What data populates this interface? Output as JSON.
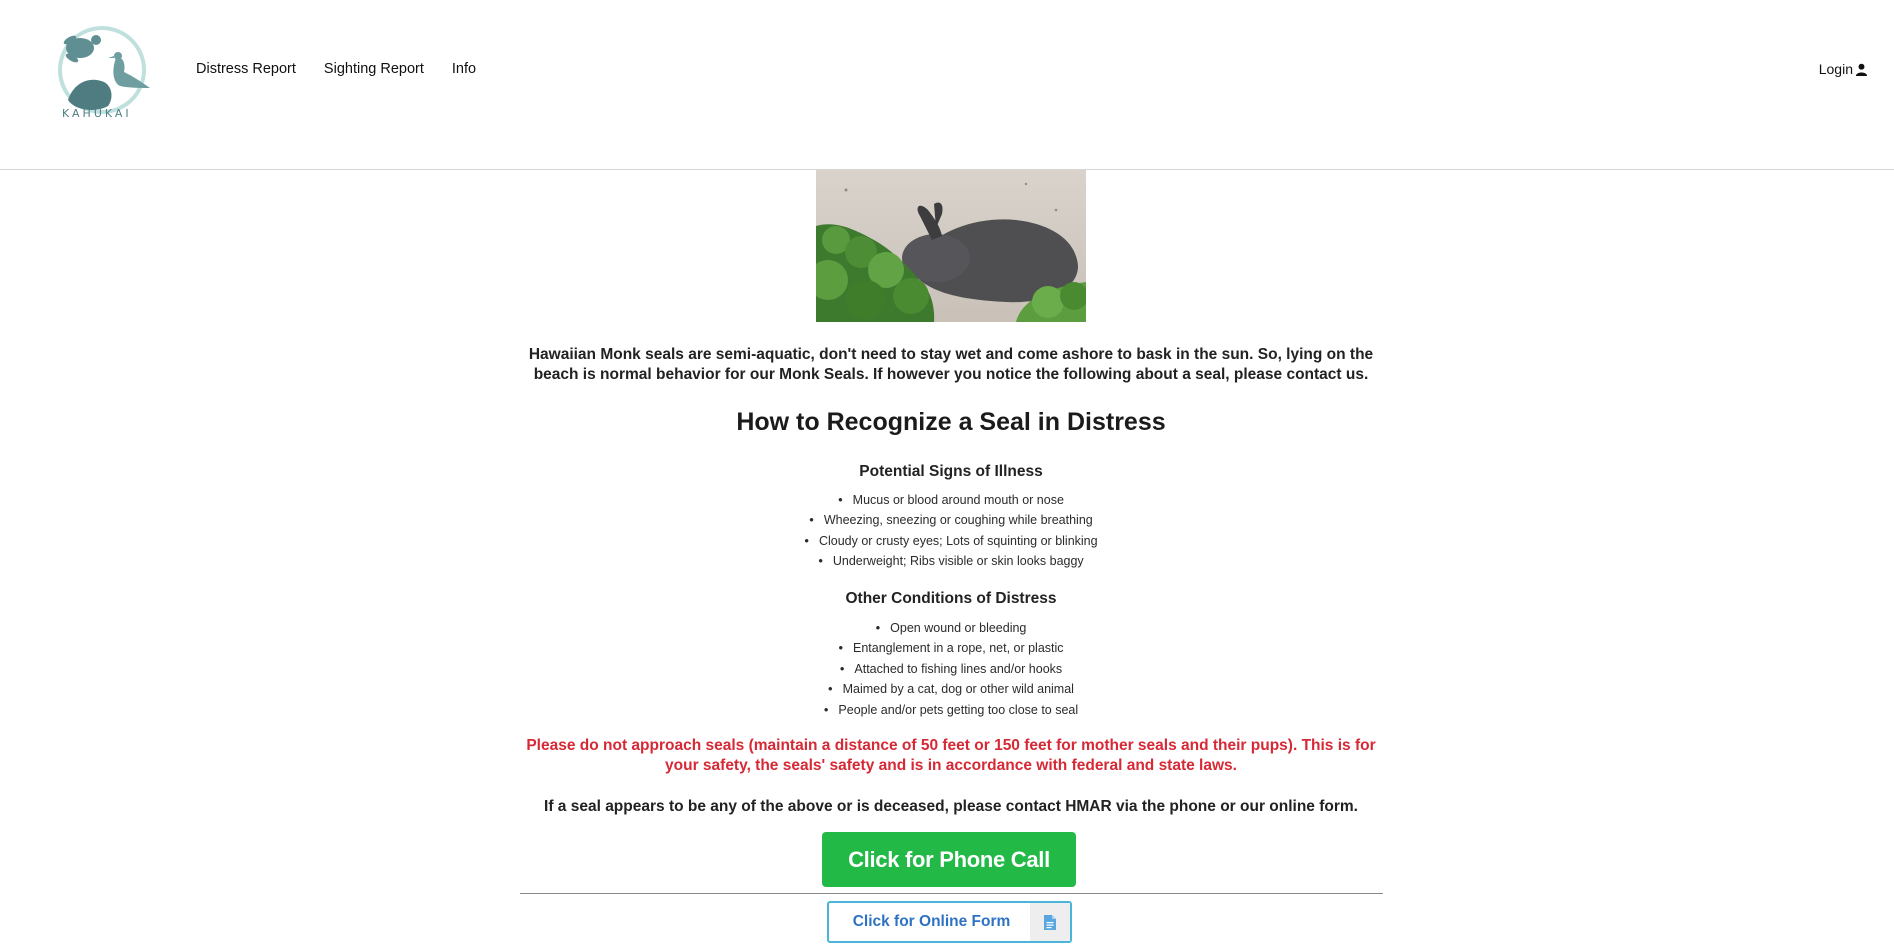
{
  "header": {
    "logo_text": "KAHUKAI",
    "nav": [
      "Distress Report",
      "Sighting Report",
      "Info"
    ],
    "login_label": "Login"
  },
  "main": {
    "intro": "Hawaiian Monk seals are semi-aquatic, don't need to stay wet and come ashore to bask in the sun. So, lying on the beach is normal behavior for our Monk Seals. If however you notice the following about a seal, please contact us.",
    "heading": "How to Recognize a Seal in Distress",
    "illness": {
      "title": "Potential Signs of Illness",
      "items": [
        "Mucus or blood around mouth or nose",
        "Wheezing, sneezing or coughing while breathing",
        "Cloudy or crusty eyes; Lots of squinting or blinking",
        "Underweight; Ribs visible or skin looks baggy"
      ]
    },
    "other": {
      "title": "Other Conditions of Distress",
      "items": [
        "Open wound or bleeding",
        "Entanglement in a rope, net, or plastic",
        "Attached to fishing lines and/or hooks",
        "Maimed by a cat, dog or other wild animal",
        "People and/or pets getting too close to seal"
      ]
    },
    "warning": "Please do not approach seals (maintain a distance of 50 feet or 150 feet for mother seals and their pups). This is for your safety, the seals' safety and is in accordance with federal and state laws.",
    "contact_line": "If a seal appears to be any of the above or is deceased, please contact HMAR via the phone or our online form.",
    "phone_button": "Click for Phone Call",
    "form_button": "Click for Online Form"
  },
  "colors": {
    "warning": "#d62935",
    "phone_button": "#22b947",
    "form_button_border": "#49b5d8",
    "form_button_text": "#2f72c3",
    "logo": "#5f8f92"
  },
  "icons": {
    "login": "user-icon",
    "form": "document-icon"
  }
}
